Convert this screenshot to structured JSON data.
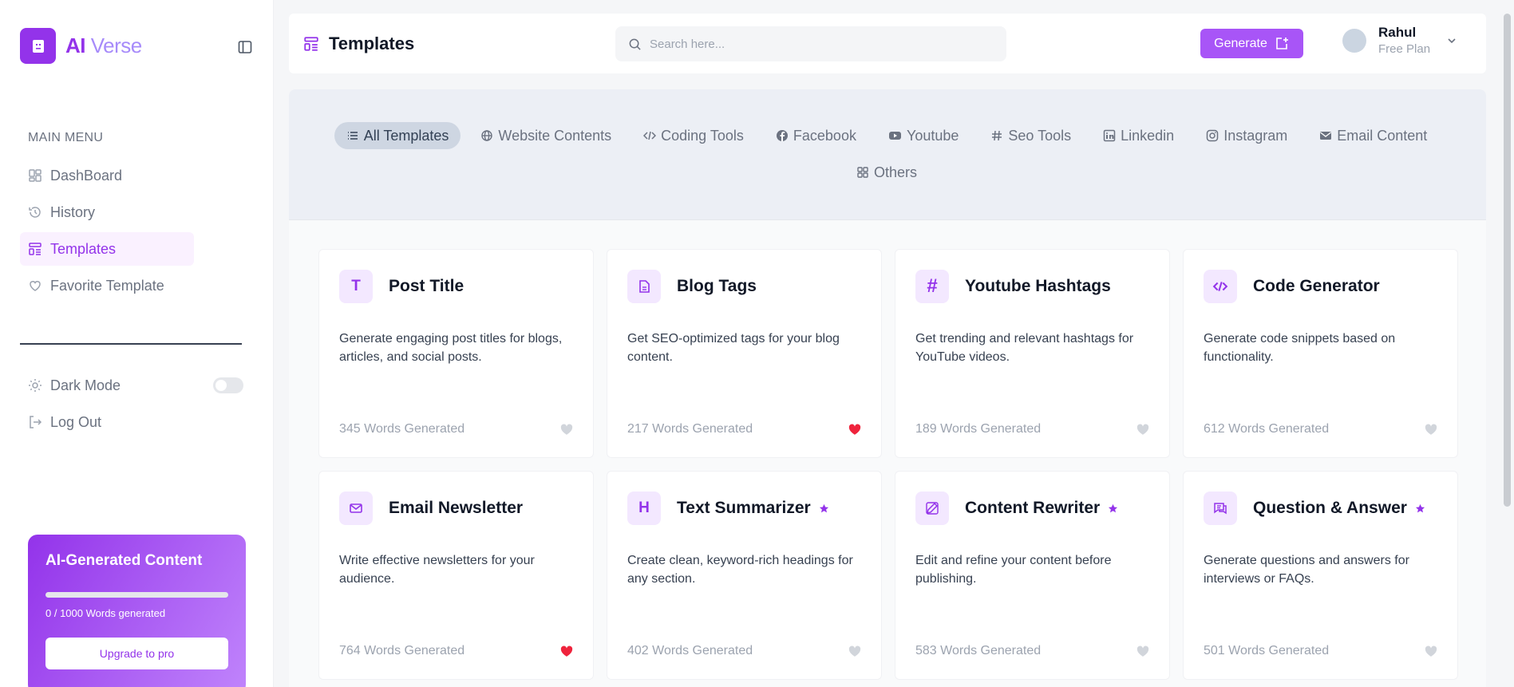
{
  "brand": {
    "name_bold": "AI",
    "name_light": "Verse",
    "accent": "#9333ea"
  },
  "sidebar": {
    "menu_title": "MAIN MENU",
    "items": [
      {
        "label": "DashBoard",
        "icon": "dashboard-icon",
        "active": false
      },
      {
        "label": "History",
        "icon": "history-icon",
        "active": false
      },
      {
        "label": "Templates",
        "icon": "templates-icon",
        "active": true
      },
      {
        "label": "Favorite Template",
        "icon": "heart-outline-icon",
        "active": false
      }
    ],
    "dark_mode_label": "Dark Mode",
    "dark_mode_on": false,
    "logout_label": "Log Out"
  },
  "promo": {
    "title": "AI-Generated Content",
    "usage": "0 / 1000 Words generated",
    "progress": 0,
    "button": "Upgrade to pro"
  },
  "header": {
    "title": "Templates",
    "search_placeholder": "Search here...",
    "generate_label": "Generate",
    "user_name": "Rahul",
    "user_plan": "Free Plan"
  },
  "filters": [
    {
      "label": "All Templates",
      "icon": "list-icon",
      "active": true
    },
    {
      "label": "Website Contents",
      "icon": "globe-icon",
      "active": false
    },
    {
      "label": "Coding Tools",
      "icon": "code-icon",
      "active": false
    },
    {
      "label": "Facebook",
      "icon": "facebook-icon",
      "active": false
    },
    {
      "label": "Youtube",
      "icon": "youtube-icon",
      "active": false
    },
    {
      "label": "Seo Tools",
      "icon": "hash-icon",
      "active": false
    },
    {
      "label": "Linkedin",
      "icon": "linkedin-icon",
      "active": false
    },
    {
      "label": "Instagram",
      "icon": "instagram-icon",
      "active": false
    },
    {
      "label": "Email Content",
      "icon": "mail-icon",
      "active": false
    },
    {
      "label": "Others",
      "icon": "grid-icon",
      "active": false
    }
  ],
  "cards": [
    {
      "title": "Post Title",
      "icon": "letter-t-icon",
      "glyph": "T",
      "desc": "Generate engaging post titles for blogs, articles, and social posts.",
      "count": "345 Words Generated",
      "favorite": false,
      "premium": false
    },
    {
      "title": "Blog Tags",
      "icon": "document-icon",
      "glyph": "",
      "desc": "Get SEO-optimized tags for your blog content.",
      "count": "217 Words Generated",
      "favorite": true,
      "premium": false
    },
    {
      "title": "Youtube Hashtags",
      "icon": "hash-icon",
      "glyph": "#",
      "desc": "Get trending and relevant hashtags for YouTube videos.",
      "count": "189 Words Generated",
      "favorite": false,
      "premium": false
    },
    {
      "title": "Code Generator",
      "icon": "code-icon",
      "glyph": "",
      "desc": "Generate code snippets based on functionality.",
      "count": "612 Words Generated",
      "favorite": false,
      "premium": false
    },
    {
      "title": "Email Newsletter",
      "icon": "mail-icon",
      "glyph": "",
      "desc": "Write effective newsletters for your audience.",
      "count": "764 Words Generated",
      "favorite": true,
      "premium": false
    },
    {
      "title": "Text Summarizer",
      "icon": "letter-h-icon",
      "glyph": "H",
      "desc": "Create clean, keyword-rich headings for any section.",
      "count": "402 Words Generated",
      "favorite": false,
      "premium": true
    },
    {
      "title": "Content Rewriter",
      "icon": "edit-icon",
      "glyph": "",
      "desc": "Edit and refine your content before publishing.",
      "count": "583 Words Generated",
      "favorite": false,
      "premium": true
    },
    {
      "title": "Question & Answer",
      "icon": "chat-icon",
      "glyph": "",
      "desc": "Generate questions and answers for interviews or FAQs.",
      "count": "501 Words Generated",
      "favorite": false,
      "premium": true
    }
  ],
  "colors": {
    "favorite": "#ef233c",
    "heart_idle": "#d1d5db",
    "premium_star": "#9333ea"
  }
}
